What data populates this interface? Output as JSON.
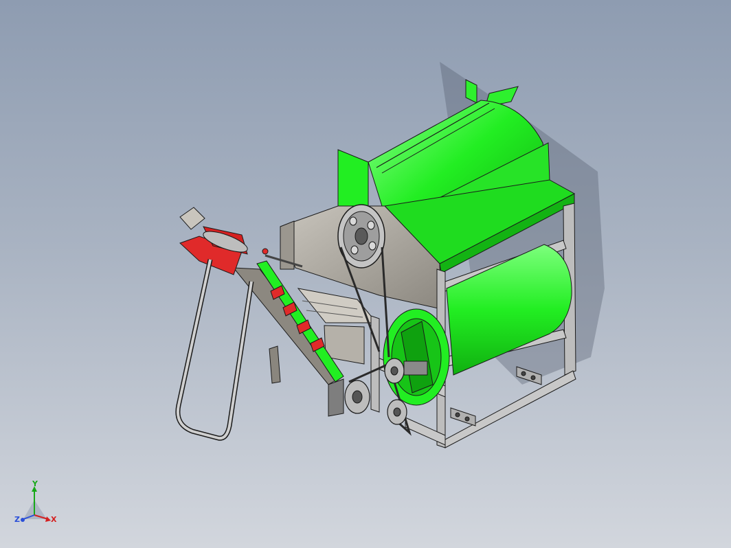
{
  "viewport": {
    "background_top": "#8e9cb1",
    "background_bottom": "#d2d6dd"
  },
  "model": {
    "icon": "cad-assembly-3d-model",
    "colors": {
      "body_green": "#22ee22",
      "body_green_shadow": "#13b313",
      "frame_gray": "#b8b8b8",
      "frame_dark": "#6c6c6c",
      "conveyor_red": "#e02a2a",
      "handle_gray": "#c9c9c9"
    }
  },
  "triad": {
    "x_label": "X",
    "y_label": "Y",
    "z_label": "Z",
    "x_color": "#d42020",
    "y_color": "#18a818",
    "z_color": "#2a4fd8"
  }
}
